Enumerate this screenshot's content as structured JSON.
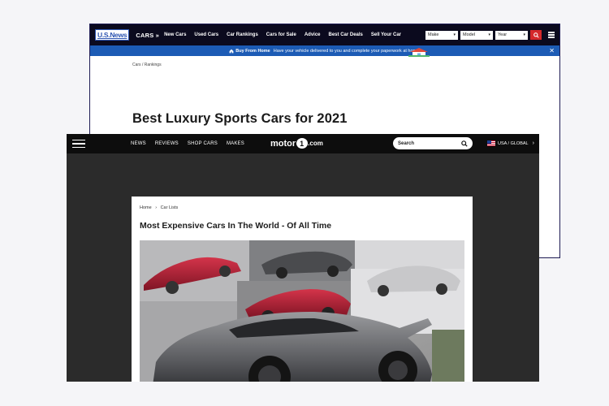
{
  "usnews": {
    "logo": "U.S.News",
    "section": "CARS »",
    "nav": [
      "New Cars",
      "Used Cars",
      "Car Rankings",
      "Cars for Sale",
      "Advice",
      "Best Car Deals",
      "Sell Your Car"
    ],
    "selects": [
      "Make",
      "Model",
      "Year"
    ],
    "banner_strong": "Buy From Home",
    "banner_text": "Have your vehicle delivered to you and complete your paperwork at home.",
    "breadcrumb": "Cars  /  Rankings",
    "title": "Best Luxury Sports Cars for 2021"
  },
  "motor1": {
    "nav": [
      "NEWS",
      "REVIEWS",
      "SHOP CARS",
      "MAKES"
    ],
    "logo_pre": "motor",
    "logo_mid": "1",
    "logo_post": ".com",
    "search_placeholder": "Search",
    "region": "USA / GLOBAL",
    "breadcrumb_home": "Home",
    "breadcrumb_section": "Car Lists",
    "breadcrumb_sep": "›",
    "title": "Most Expensive Cars In The World - Of All Time"
  },
  "colors": {
    "usn_nav_bg": "#0b0a1e",
    "usn_banner": "#1c5bb5",
    "usn_search": "#d5282b",
    "motor1_nav": "#0d0d0d",
    "motor1_bg": "#2b2b2b"
  }
}
